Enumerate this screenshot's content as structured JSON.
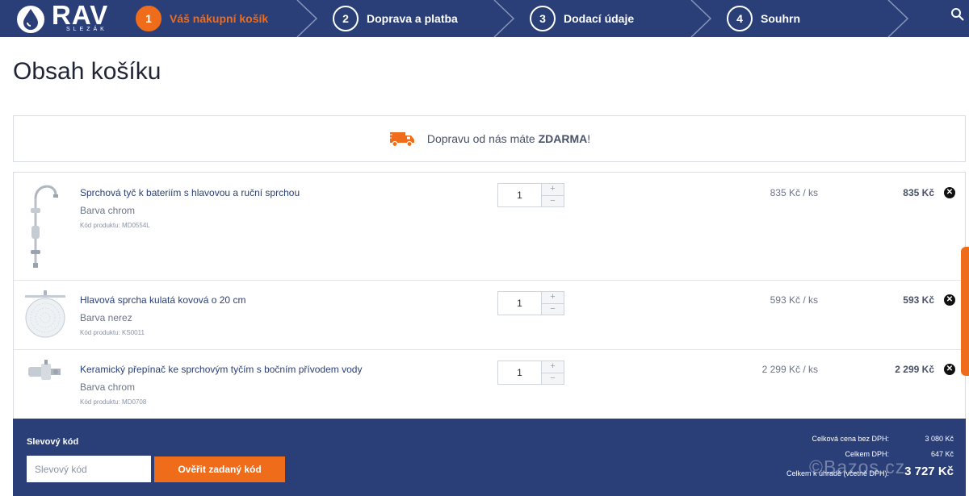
{
  "brand": {
    "name": "RAV",
    "subtitle": "SLEZÁK"
  },
  "steps": [
    {
      "num": "1",
      "label": "Váš nákupní košík",
      "active": true
    },
    {
      "num": "2",
      "label": "Doprava a platba",
      "active": false
    },
    {
      "num": "3",
      "label": "Dodací údaje",
      "active": false
    },
    {
      "num": "4",
      "label": "Souhrn",
      "active": false
    }
  ],
  "page_title": "Obsah košíku",
  "shipping_banner": {
    "text": "Dopravu od nás máte ",
    "highlight": "ZDARMA",
    "suffix": "!"
  },
  "items": [
    {
      "name": "Sprchová tyč k bateriím s hlavovou a ruční sprchou",
      "variant": "Barva chrom",
      "code": "Kód produktu: MD0554L",
      "qty": "1",
      "unit_price": "835 Kč / ks",
      "total": "835 Kč",
      "thumb": "shower-rod"
    },
    {
      "name": "Hlavová sprcha kulatá kovová o 20 cm",
      "variant": "Barva nerez",
      "code": "Kód produktu: KS0011",
      "qty": "1",
      "unit_price": "593 Kč / ks",
      "total": "593 Kč",
      "thumb": "shower-head"
    },
    {
      "name": "Keramický přepínač ke sprchovým tyčím s bočním přívodem vody",
      "variant": "Barva chrom",
      "code": "Kód produktu: MD0708",
      "qty": "1",
      "unit_price": "2 299 Kč / ks",
      "total": "2 299 Kč",
      "thumb": "diverter-valve"
    }
  ],
  "qty_controls": {
    "plus": "+",
    "minus": "−"
  },
  "remove_symbol": "✕",
  "coupon": {
    "label": "Slevový kód",
    "placeholder": "Slevový kód",
    "button": "Ověřit zadaný kód"
  },
  "summary": {
    "without_vat_label": "Celková cena bez DPH:",
    "without_vat_value": "3 080 Kč",
    "vat_label": "Celkem DPH:",
    "vat_value": "647 Kč",
    "total_label": "Celkem k úhradě (včetně DPH):",
    "total_value": "3 727 Kč"
  },
  "watermark": "©Bazos.cz",
  "colors": {
    "navy": "#2a3f78",
    "orange": "#ef6c1a"
  }
}
